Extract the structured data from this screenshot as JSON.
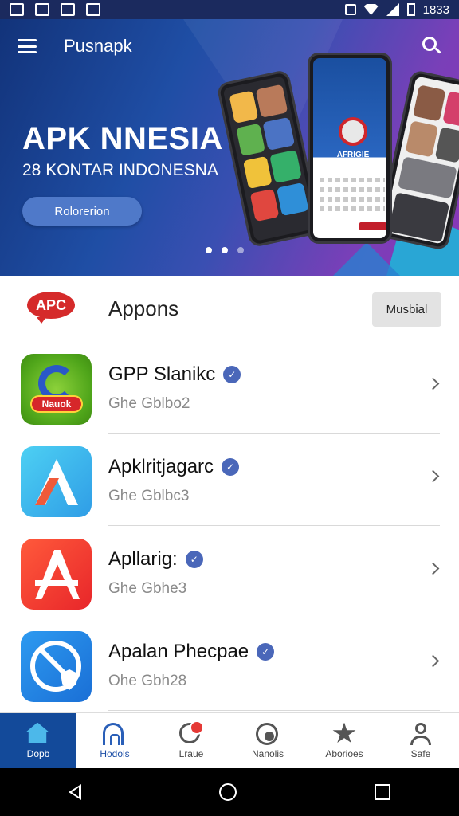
{
  "status_bar": {
    "time": "1833"
  },
  "header": {
    "app_title": "Pusnapk"
  },
  "banner": {
    "title": "APK NNESIA",
    "subtitle": "28 KONTAR INDONESNA",
    "button_label": "Rolorerion",
    "phone_screen_label": "AFRIGIE"
  },
  "section": {
    "logo_text": "APC",
    "title": "Appons",
    "button_label": "Musbial"
  },
  "apps": [
    {
      "name": "GPP Slanikc",
      "subtitle": "Ghe Gblbo2",
      "icon_label": "Nauok"
    },
    {
      "name": "Apklritjagarc",
      "subtitle": "Ghe Gblbc3"
    },
    {
      "name": "Apllarig:",
      "subtitle": "Ghe Gbhe3"
    },
    {
      "name": "Apalan Phecpae",
      "subtitle": "Ohe Gbh28"
    }
  ],
  "bottom_nav": [
    {
      "label": "Dopb"
    },
    {
      "label": "Hodols"
    },
    {
      "label": "Lraue"
    },
    {
      "label": "Nanolis"
    },
    {
      "label": "Aborioes"
    },
    {
      "label": "Safe"
    }
  ],
  "colors": {
    "banner_start": "#12337a",
    "banner_end": "#8a36b8",
    "nav_active": "#134a9a",
    "accent_red": "#d52a2a",
    "verified_badge": "#4a67b9"
  }
}
